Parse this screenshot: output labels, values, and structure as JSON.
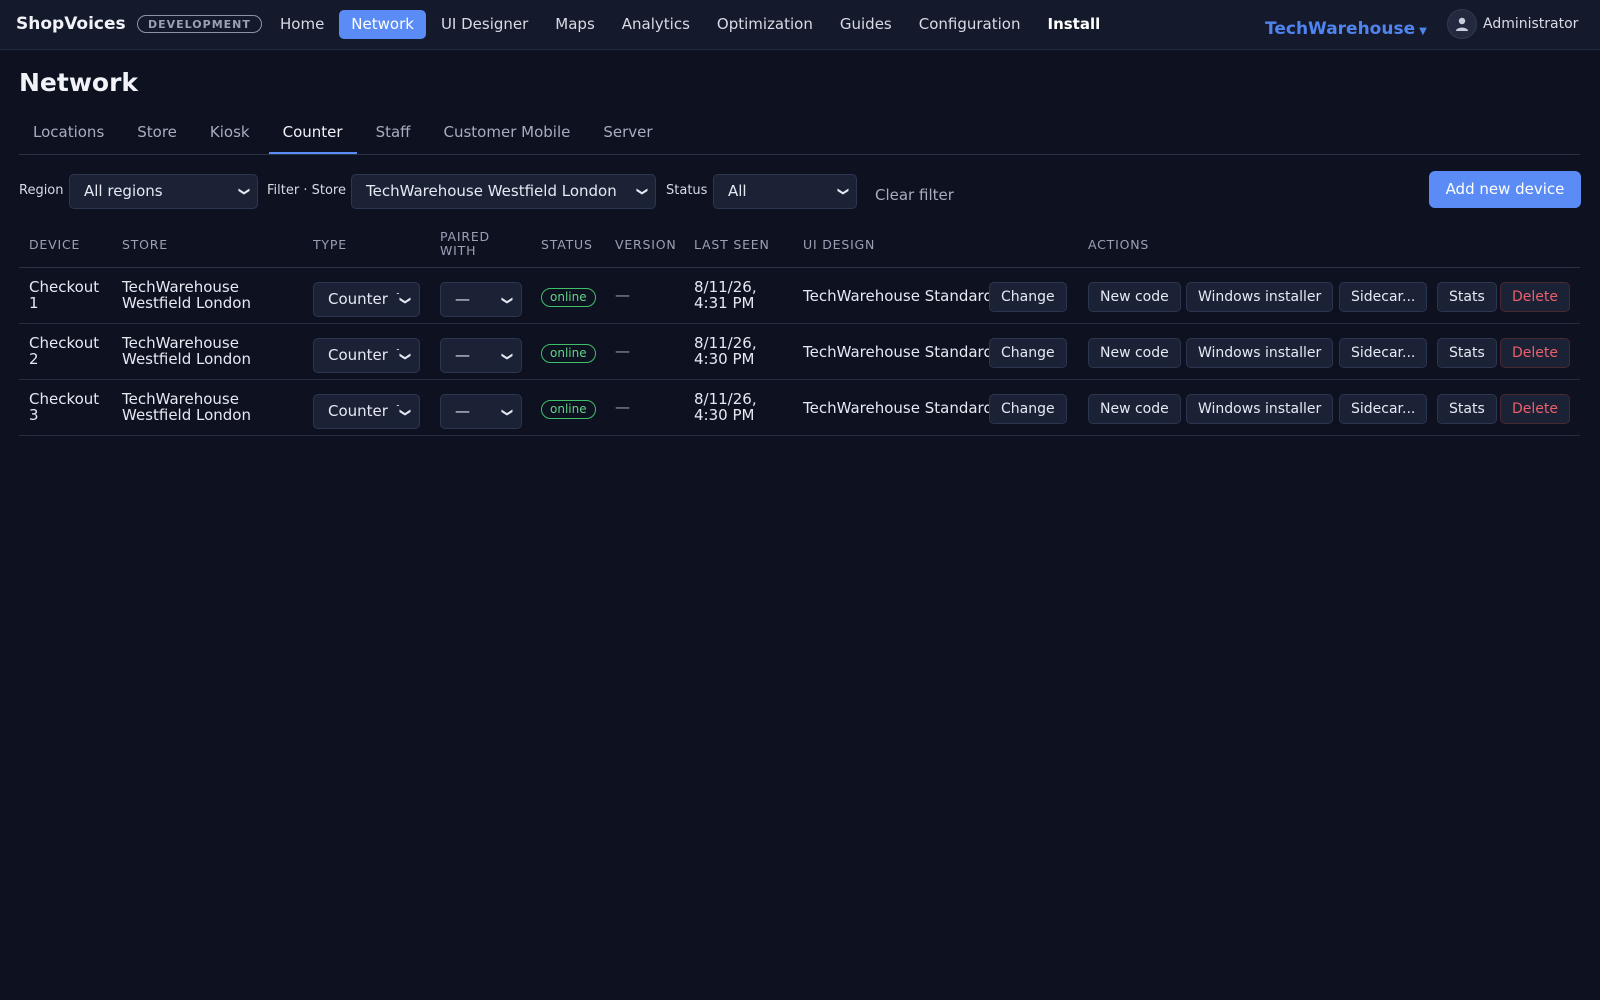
{
  "header": {
    "brand": "ShopVoices",
    "env_badge": "DEVELOPMENT",
    "nav": [
      "Home",
      "Network",
      "UI Designer",
      "Maps",
      "Analytics",
      "Optimization",
      "Guides",
      "Configuration",
      "Install"
    ],
    "active_nav": "Network",
    "tenant": "TechWarehouse",
    "user": "Administrator"
  },
  "page": {
    "title": "Network",
    "tabs": [
      "Locations",
      "Store",
      "Kiosk",
      "Counter",
      "Staff",
      "Customer Mobile",
      "Server"
    ],
    "active_tab": "Counter"
  },
  "filters": {
    "region_label": "Region",
    "region_value": "All regions",
    "store_label": "Filter · Store",
    "store_value": "TechWarehouse Westfield London",
    "status_label": "Status",
    "status_value": "All",
    "clear_label": "Clear filter",
    "add_label": "Add new device"
  },
  "table": {
    "headers": {
      "device": "DEVICE",
      "store": "STORE",
      "type": "TYPE",
      "paired_1": "PAIRED",
      "paired_2": "WITH",
      "status": "STATUS",
      "version": "VERSION",
      "last_seen": "LAST SEEN",
      "ui_design": "UI DESIGN",
      "actions": "ACTIONS"
    },
    "rows": [
      {
        "device_1": "Checkout",
        "device_2": "1",
        "store_1": "TechWarehouse",
        "store_2": "Westfield London",
        "type": "Counter A",
        "paired": "—",
        "status": "online",
        "version": "—",
        "seen_1": "8/11/26,",
        "seen_2": "4:31 PM",
        "ui_design": "TechWarehouse Standard"
      },
      {
        "device_1": "Checkout",
        "device_2": "2",
        "store_1": "TechWarehouse",
        "store_2": "Westfield London",
        "type": "Counter A",
        "paired": "—",
        "status": "online",
        "version": "—",
        "seen_1": "8/11/26,",
        "seen_2": "4:30 PM",
        "ui_design": "TechWarehouse Standard"
      },
      {
        "device_1": "Checkout",
        "device_2": "3",
        "store_1": "TechWarehouse",
        "store_2": "Westfield London",
        "type": "Counter A",
        "paired": "—",
        "status": "online",
        "version": "—",
        "seen_1": "8/11/26,",
        "seen_2": "4:30 PM",
        "ui_design": "TechWarehouse Standard"
      }
    ],
    "buttons": {
      "change": "Change",
      "new_code": "New code",
      "windows_installer": "Windows installer",
      "sidecar": "Sidecar...",
      "stats": "Stats",
      "delete": "Delete"
    }
  },
  "colors": {
    "background": "#0d1120",
    "accent": "#5b8cf5",
    "online": "#5fd487",
    "danger": "#e9606a"
  }
}
